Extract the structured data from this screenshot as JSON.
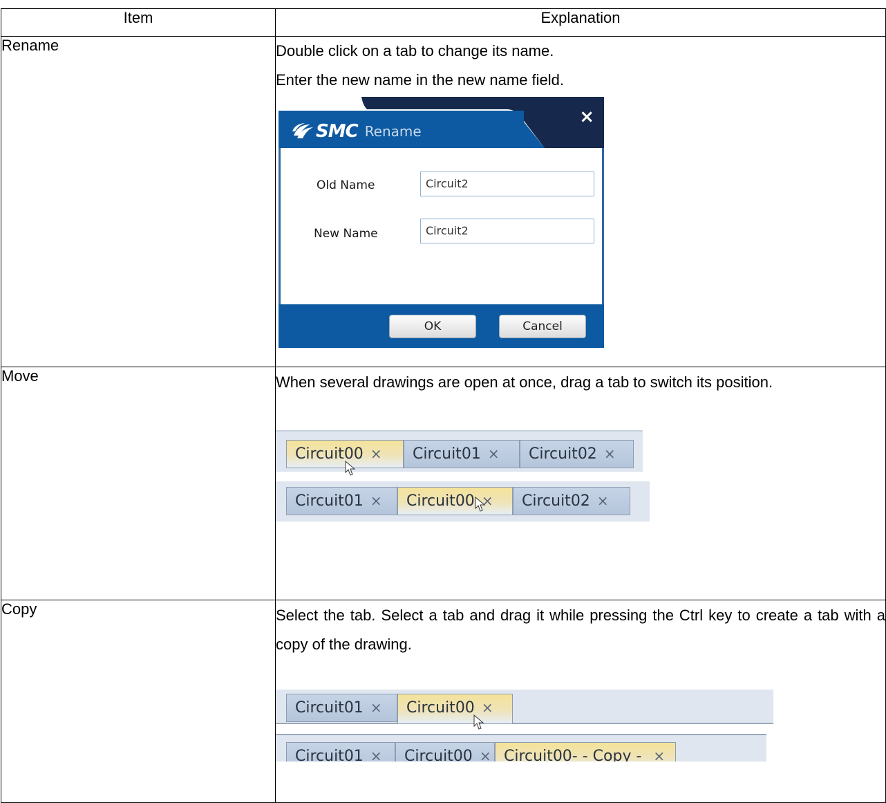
{
  "header": {
    "item": "Item",
    "explanation": "Explanation"
  },
  "rows": {
    "rename": {
      "item": "Rename",
      "lines": [
        "Double click on a tab to change its name.",
        "Enter the new name in the new name field."
      ],
      "dialog": {
        "brand": "SMC",
        "title": "Rename",
        "close": "×",
        "old_label": "Old Name",
        "old_value": "Circuit2",
        "new_label": "New Name",
        "new_value": "Circuit2",
        "ok": "OK",
        "cancel": "Cancel",
        "colors": {
          "header": "#16294d",
          "footer": "#0d5aa2",
          "border": "#2f66a6"
        }
      }
    },
    "move": {
      "item": "Move",
      "text": "When several drawings are open at once, drag a tab to switch its position.",
      "strip1": [
        "Circuit00",
        "Circuit01",
        "Circuit02"
      ],
      "strip2": [
        "Circuit01",
        "Circuit00",
        "Circuit02"
      ]
    },
    "copy": {
      "item": "Copy",
      "text": "Select the tab. Select a tab and drag it while pressing the Ctrl key to create a tab with a copy of the drawing.",
      "strip1": [
        "Circuit01",
        "Circuit00"
      ],
      "strip2": [
        "Circuit01",
        "Circuit00",
        "Circuit00- - Copy - "
      ]
    }
  },
  "tab_close": "×"
}
